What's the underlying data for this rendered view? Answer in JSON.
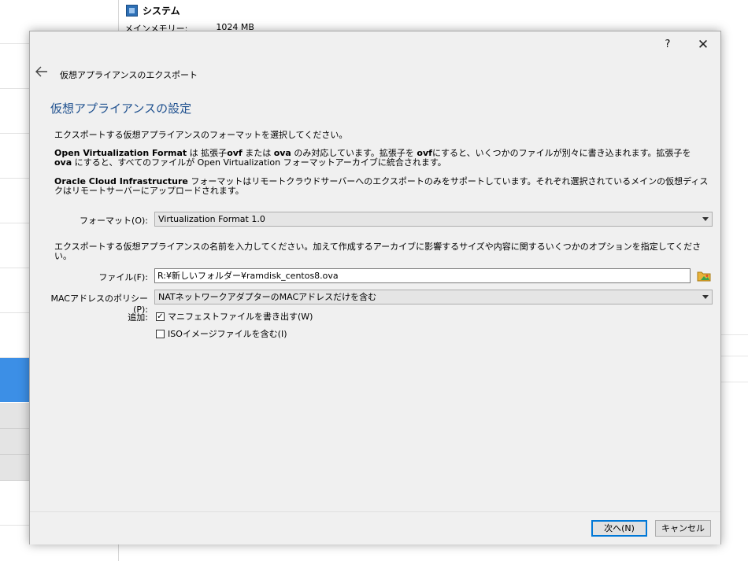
{
  "background": {
    "system_title": "システム",
    "memory_label": "メインメモリー:",
    "memory_value": "1024 MB"
  },
  "dialog": {
    "help_label": "?",
    "close_label": "✕",
    "wizard_title": "仮想アプライアンスのエクスポート",
    "page_title": "仮想アプライアンスの設定",
    "intro": "エクスポートする仮想アプライアンスのフォーマットを選択してください。",
    "ovf_bold": "Open Virtualization Format",
    "ovf_text1": " は 拡張子",
    "ovf_ext1": "ovf",
    "ovf_text2": " または ",
    "ovf_ext2": "ova",
    "ovf_text3": " のみ対応しています。拡張子を ",
    "ovf_ext3": "ovf",
    "ovf_text4": "にすると、いくつかのファイルが別々に書き込まれます。拡張子を ",
    "ovf_ext4": "ova",
    "ovf_text5": " にすると、すべてのファイルが Open Virtualization フォーマットアーカイブに統合されます。",
    "oci_bold": "Oracle Cloud Infrastructure",
    "oci_text": " フォーマットはリモートクラウドサーバーへのエクスポートのみをサポートしています。それぞれ選択されているメインの仮想ディスクはリモートサーバーにアップロードされます。",
    "format_label": "フォーマット(O):",
    "format_value": "Virtualization Format 1.0",
    "name_instruction": "エクスポートする仮想アプライアンスの名前を入力してください。加えて作成するアーカイブに影響するサイズや内容に関するいくつかのオプションを指定してください。",
    "file_label": "ファイル(F):",
    "file_value": "R:¥新しいフォルダー¥ramdisk_centos8.ova",
    "mac_label": "MACアドレスのポリシー(P):",
    "mac_value": "NATネットワークアダプターのMACアドレスだけを含む",
    "additional_label": "追加:",
    "manifest_label": "マニフェストファイルを書き出す(W)",
    "manifest_checked": true,
    "iso_label": "ISOイメージファイルを含む(I)",
    "iso_checked": false,
    "next_label": "次へ(N)",
    "cancel_label": "キャンセル"
  },
  "colors": {
    "accent": "#0078d7",
    "title_blue": "#1d4f8e",
    "selection_blue": "#3c8fe6"
  }
}
